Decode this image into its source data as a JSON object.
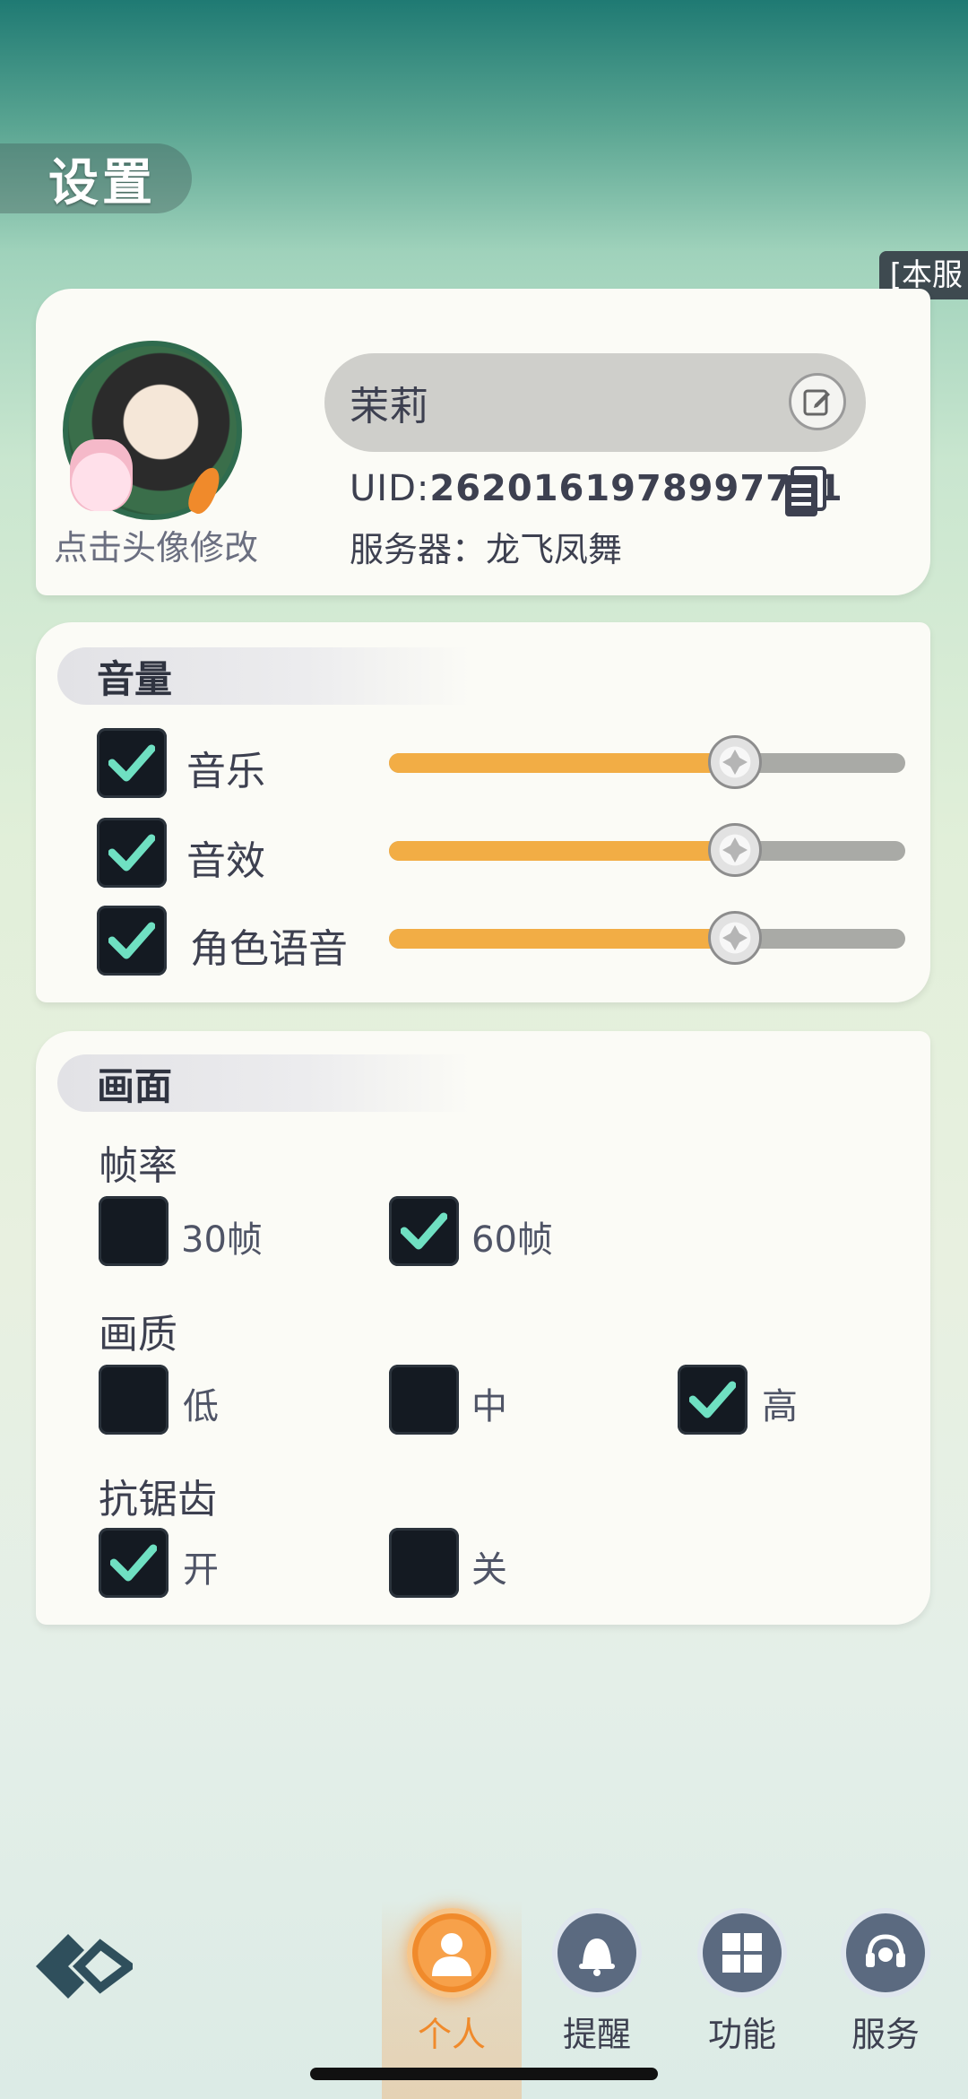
{
  "header": {
    "title": "设置",
    "corner_tag": "[本服"
  },
  "profile": {
    "avatar_hint": "点击头像修改",
    "name": "茉莉",
    "uid_prefix": "UID:",
    "uid_value": "2620161978997721",
    "server_label": "服务器：",
    "server_name": "龙飞凤舞"
  },
  "volume": {
    "title": "音量",
    "items": [
      {
        "label": "音乐",
        "checked": true,
        "level": 0.67
      },
      {
        "label": "音效",
        "checked": true,
        "level": 0.67
      },
      {
        "label": "角色语音",
        "checked": true,
        "level": 0.67
      }
    ]
  },
  "display": {
    "title": "画面",
    "fps": {
      "label": "帧率",
      "options": [
        {
          "label": "30帧",
          "checked": false
        },
        {
          "label": "60帧",
          "checked": true
        }
      ]
    },
    "quality": {
      "label": "画质",
      "options": [
        {
          "label": "低",
          "checked": false
        },
        {
          "label": "中",
          "checked": false
        },
        {
          "label": "高",
          "checked": true
        }
      ]
    },
    "antialias": {
      "label": "抗锯齿",
      "options": [
        {
          "label": "开",
          "checked": true
        },
        {
          "label": "关",
          "checked": false
        }
      ]
    }
  },
  "nav": {
    "items": [
      {
        "label": "个人",
        "icon": "person-icon",
        "active": true
      },
      {
        "label": "提醒",
        "icon": "bell-icon",
        "active": false
      },
      {
        "label": "功能",
        "icon": "grid-icon",
        "active": false
      },
      {
        "label": "服务",
        "icon": "headset-icon",
        "active": false
      }
    ]
  },
  "colors": {
    "accent": "#f2ad45",
    "check": "#6fe0c2",
    "checkbox_bg": "#141a22",
    "active_nav": "#f08a2b"
  }
}
